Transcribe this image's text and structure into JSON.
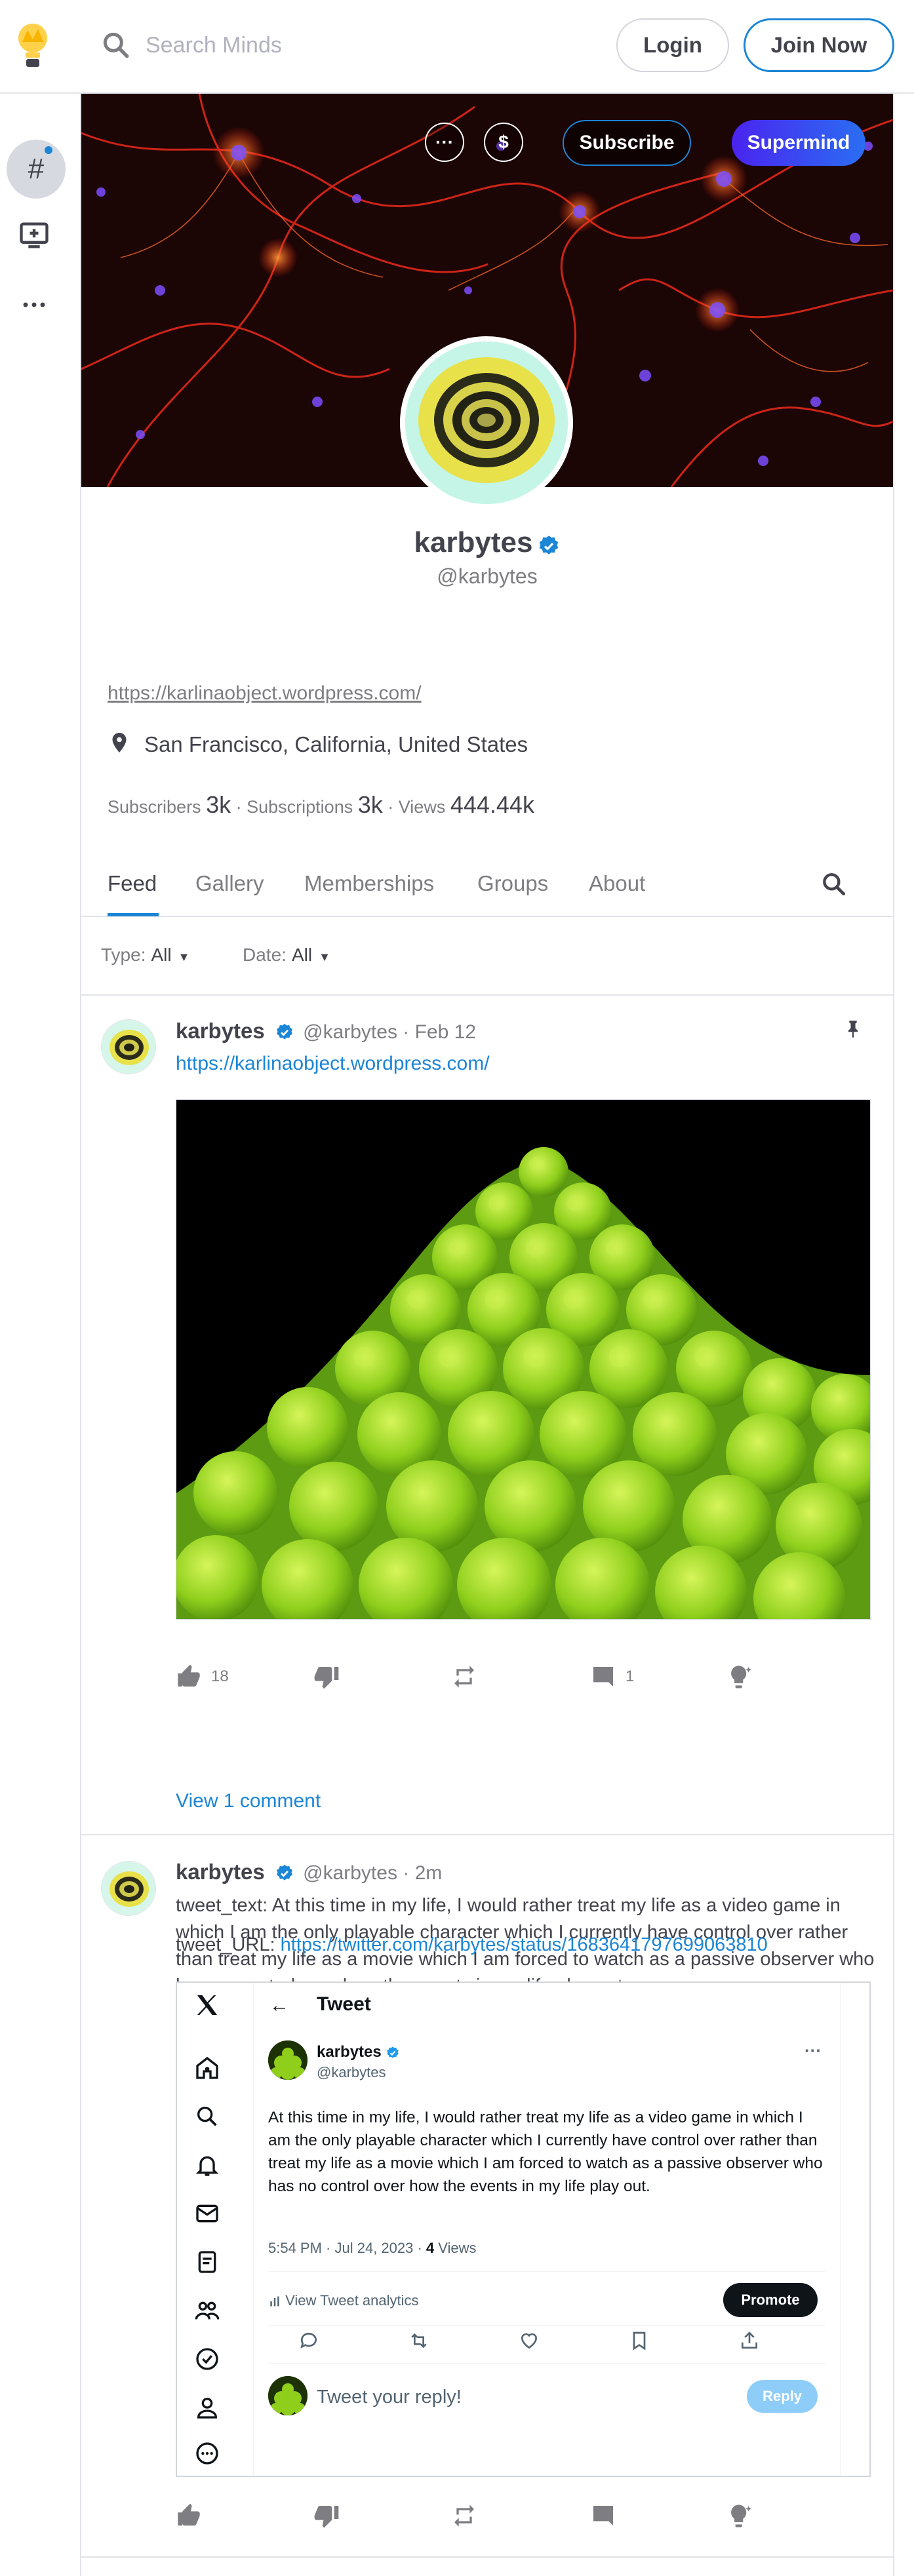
{
  "topbar": {
    "search_placeholder": "Search Minds",
    "login_label": "Login",
    "join_label": "Join Now"
  },
  "sidebar": {
    "items": [
      "hashtag-icon",
      "add-screen-icon",
      "more-icon"
    ]
  },
  "banner": {
    "more_label": "···",
    "tip_label": "$",
    "subscribe_label": "Subscribe",
    "supermind_label": "Supermind"
  },
  "profile": {
    "name": "karbytes",
    "handle": "@karbytes",
    "link": "https://karlinaobject.wordpress.com/",
    "location": "San Francisco, California, United States",
    "stats": {
      "subscribers_label": "Subscribers",
      "subscribers": "3k",
      "subscriptions_label": "Subscriptions",
      "subscriptions": "3k",
      "views_label": "Views",
      "views": "444.44k"
    }
  },
  "tabs": [
    "Feed",
    "Gallery",
    "Memberships",
    "Groups",
    "About"
  ],
  "filters": {
    "type_label": "Type:",
    "type_value": "All",
    "date_label": "Date:",
    "date_value": "All"
  },
  "posts": [
    {
      "name": "karbytes",
      "meta": "@karbytes · Feb 12",
      "link": "https://karlinaobject.wordpress.com/",
      "likes": "18",
      "comments": "1",
      "view_comments": "View 1 comment"
    },
    {
      "name": "karbytes",
      "meta": "@karbytes · 2m",
      "text": "tweet_text: At this time in my life, I would rather treat my life as a video game in which I am the only playable character which I currently have control over rather than treat my life as a movie which I am forced to watch as a passive observer who has no control over how the events in my life play out.",
      "url_label": "tweet_URL:",
      "url": "https://twitter.com/karbytes/status/1683641797699063810"
    }
  ],
  "tweet": {
    "back": "←",
    "title": "Tweet",
    "name": "karbytes",
    "handle": "@karbytes",
    "more": "···",
    "text": "At this time in my life, I would rather treat my life as a video game in which I am the only playable character which I currently have control over rather than treat my life as a movie which I am forced to watch as a passive observer who has no control over how the events in my life play out.",
    "time": "5:54 PM · Jul 24, 2023 · ",
    "views_count": "4",
    "views_label": " Views",
    "analytics": "View Tweet analytics",
    "promote": "Promote",
    "reply_placeholder": "Tweet your reply!",
    "reply_button": "Reply"
  },
  "colors": {
    "accent": "#1b85d6",
    "text": "#43434d",
    "muted": "#7d7d82",
    "border": "#e3e4e9",
    "supermind_gradient_start": "#4a24f0",
    "supermind_gradient_end": "#2a6ef2"
  }
}
